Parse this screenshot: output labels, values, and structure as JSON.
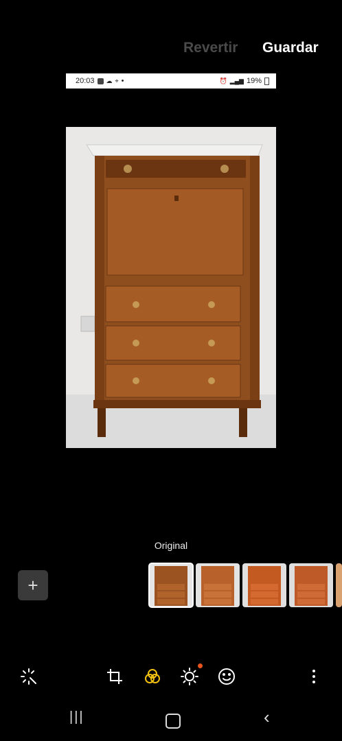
{
  "header": {
    "revert_label": "Revertir",
    "save_label": "Guardar"
  },
  "image_status_bar": {
    "time": "20:03",
    "battery": "19%"
  },
  "filters": {
    "current_label": "Original",
    "add_icon": "plus-icon",
    "thumbnail_count": 5
  },
  "toolbar": {
    "tools": [
      "auto-enhance-icon",
      "crop-rotate-icon",
      "filters-icon",
      "brightness-icon",
      "emoji-sticker-icon",
      "more-options-icon"
    ],
    "active_tool": "filters-icon",
    "accent_color": "#f2c10f",
    "badge_color": "#e8541e"
  },
  "system_nav": {
    "icons": [
      "recents-icon",
      "home-icon",
      "back-icon"
    ]
  }
}
